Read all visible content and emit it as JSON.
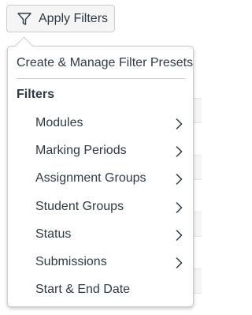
{
  "toolbar": {
    "apply_filters_label": "Apply Filters",
    "funnel_icon": "funnel-icon"
  },
  "popover": {
    "presets_label": "Create & Manage Filter Presets",
    "filters_heading": "Filters",
    "items": [
      {
        "label": "Modules",
        "has_submenu": true
      },
      {
        "label": "Marking Periods",
        "has_submenu": true
      },
      {
        "label": "Assignment Groups",
        "has_submenu": true
      },
      {
        "label": "Student Groups",
        "has_submenu": true
      },
      {
        "label": "Status",
        "has_submenu": true
      },
      {
        "label": "Submissions",
        "has_submenu": true
      },
      {
        "label": "Start & End Date",
        "has_submenu": false
      }
    ]
  },
  "colors": {
    "text": "#2d3b45",
    "border": "#c7cdd1",
    "button_bg": "#f5f5f5"
  }
}
